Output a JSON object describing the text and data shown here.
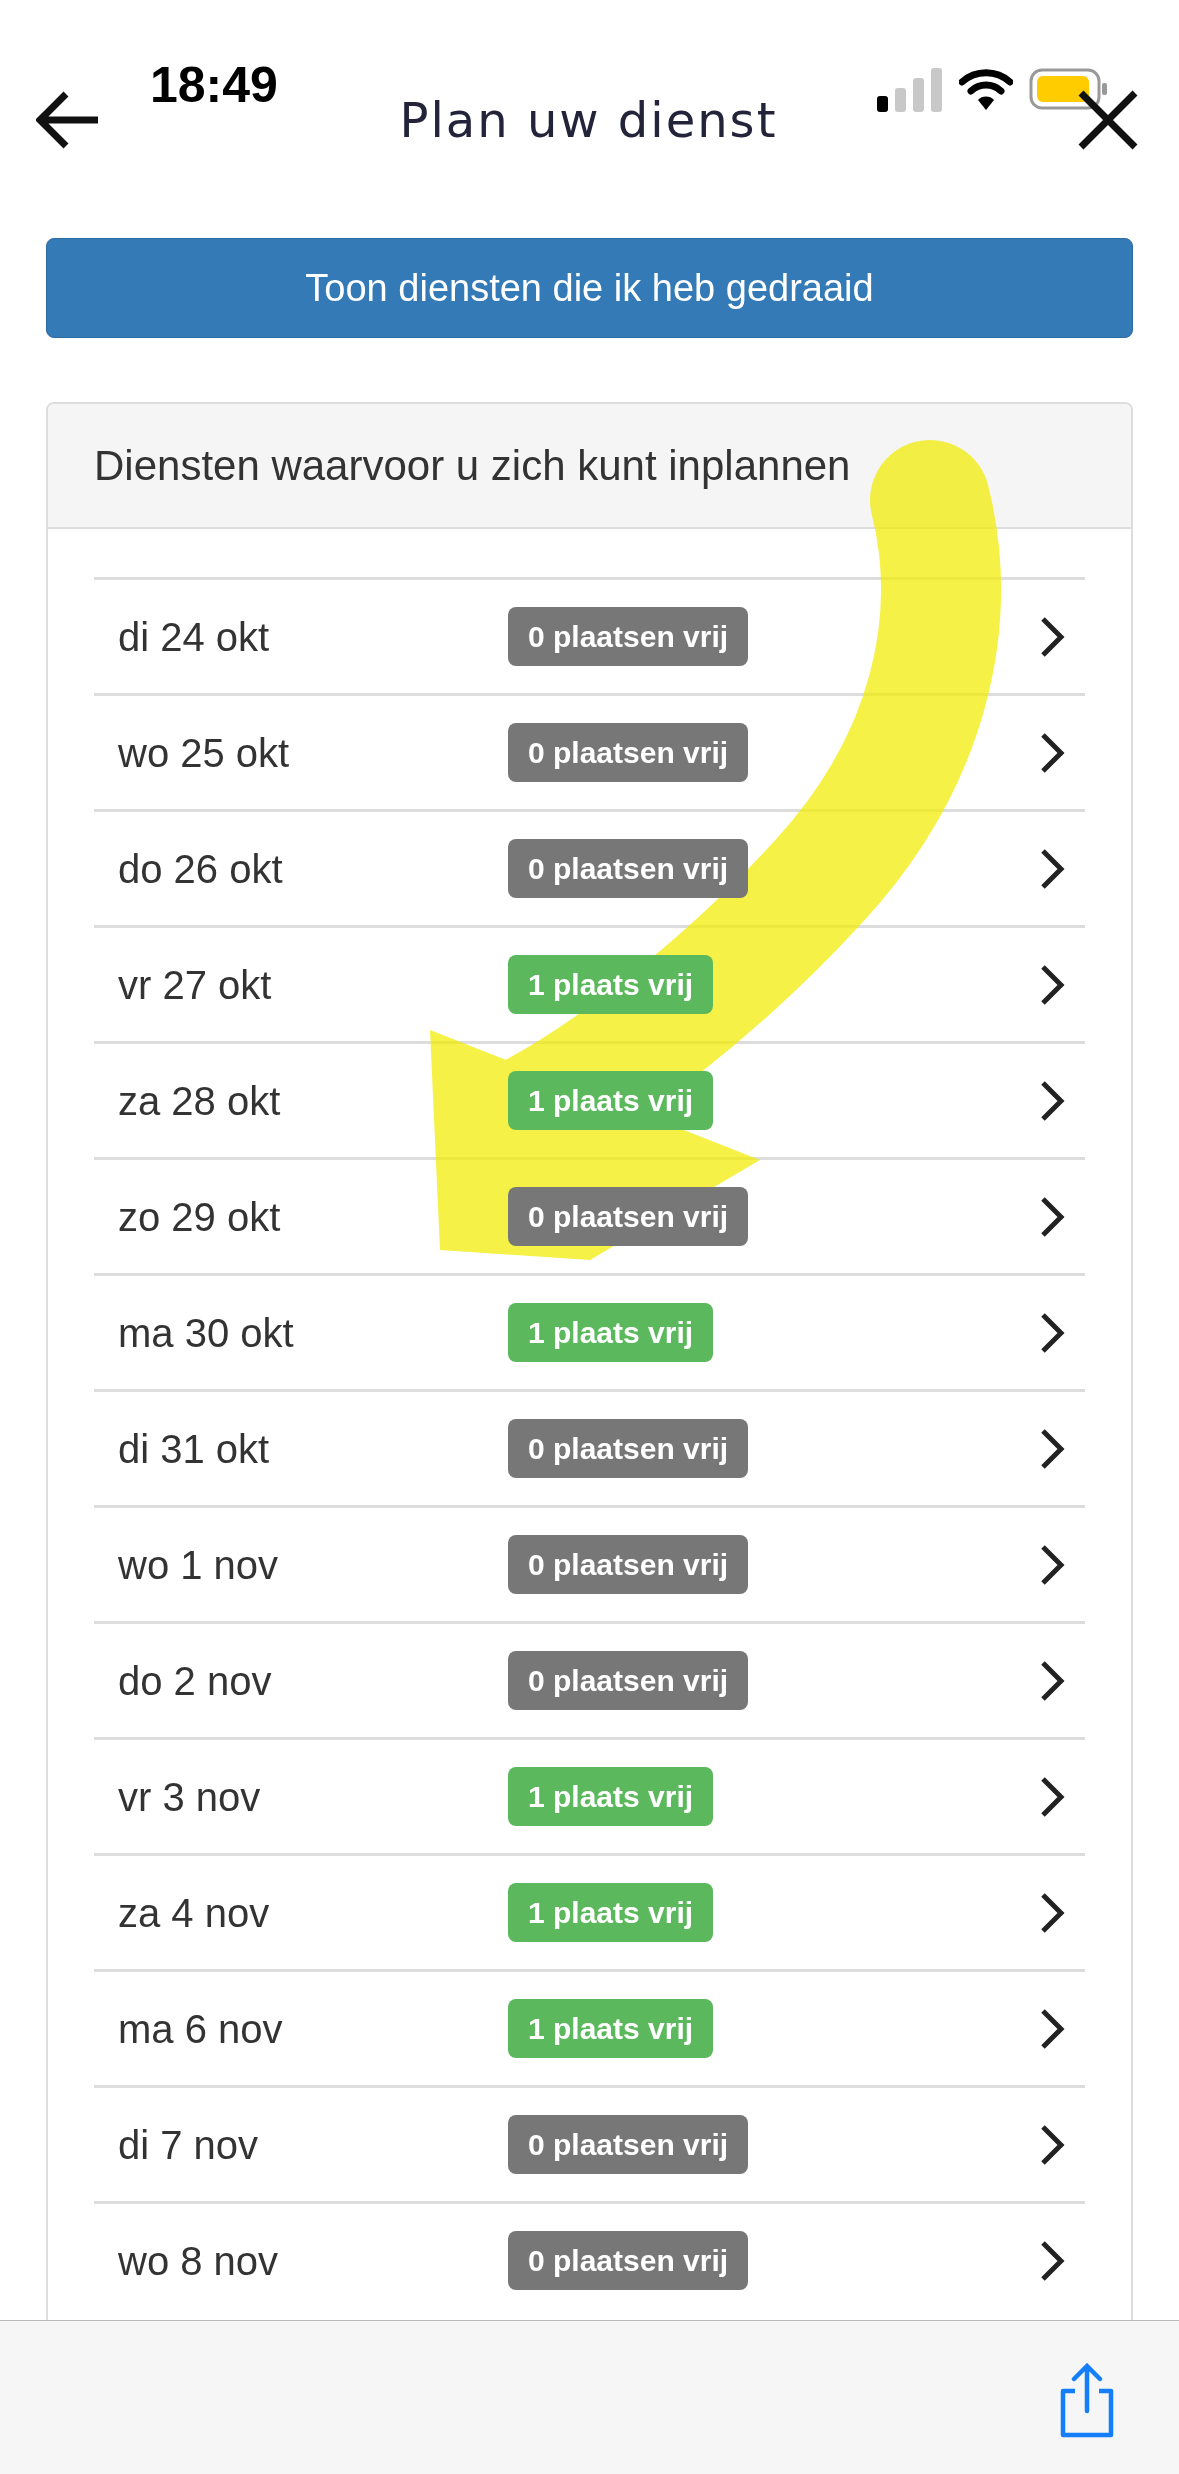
{
  "status_bar": {
    "time": "18:49"
  },
  "header": {
    "title": "Plan uw dienst"
  },
  "history_button": {
    "label": "Toon diensten die ik heb gedraaid"
  },
  "panel": {
    "title": "Diensten waarvoor u zich kunt inplannen",
    "rows": [
      {
        "date": "di 24 okt",
        "badge": "0 plaatsen vrij",
        "kind": "full"
      },
      {
        "date": "wo 25 okt",
        "badge": "0 plaatsen vrij",
        "kind": "full"
      },
      {
        "date": "do 26 okt",
        "badge": "0 plaatsen vrij",
        "kind": "full"
      },
      {
        "date": "vr 27 okt",
        "badge": "1 plaats vrij",
        "kind": "free"
      },
      {
        "date": "za 28 okt",
        "badge": "1 plaats vrij",
        "kind": "free"
      },
      {
        "date": "zo 29 okt",
        "badge": "0 plaatsen vrij",
        "kind": "full"
      },
      {
        "date": "ma 30 okt",
        "badge": "1 plaats vrij",
        "kind": "free"
      },
      {
        "date": "di 31 okt",
        "badge": "0 plaatsen vrij",
        "kind": "full"
      },
      {
        "date": "wo 1 nov",
        "badge": "0 plaatsen vrij",
        "kind": "full"
      },
      {
        "date": "do 2 nov",
        "badge": "0 plaatsen vrij",
        "kind": "full"
      },
      {
        "date": "vr 3 nov",
        "badge": "1 plaats vrij",
        "kind": "free"
      },
      {
        "date": "za 4 nov",
        "badge": "1 plaats vrij",
        "kind": "free"
      },
      {
        "date": "ma 6 nov",
        "badge": "1 plaats vrij",
        "kind": "free"
      },
      {
        "date": "di 7 nov",
        "badge": "0 plaatsen vrij",
        "kind": "full"
      },
      {
        "date": "wo 8 nov",
        "badge": "0 plaatsen vrij",
        "kind": "full"
      }
    ]
  }
}
